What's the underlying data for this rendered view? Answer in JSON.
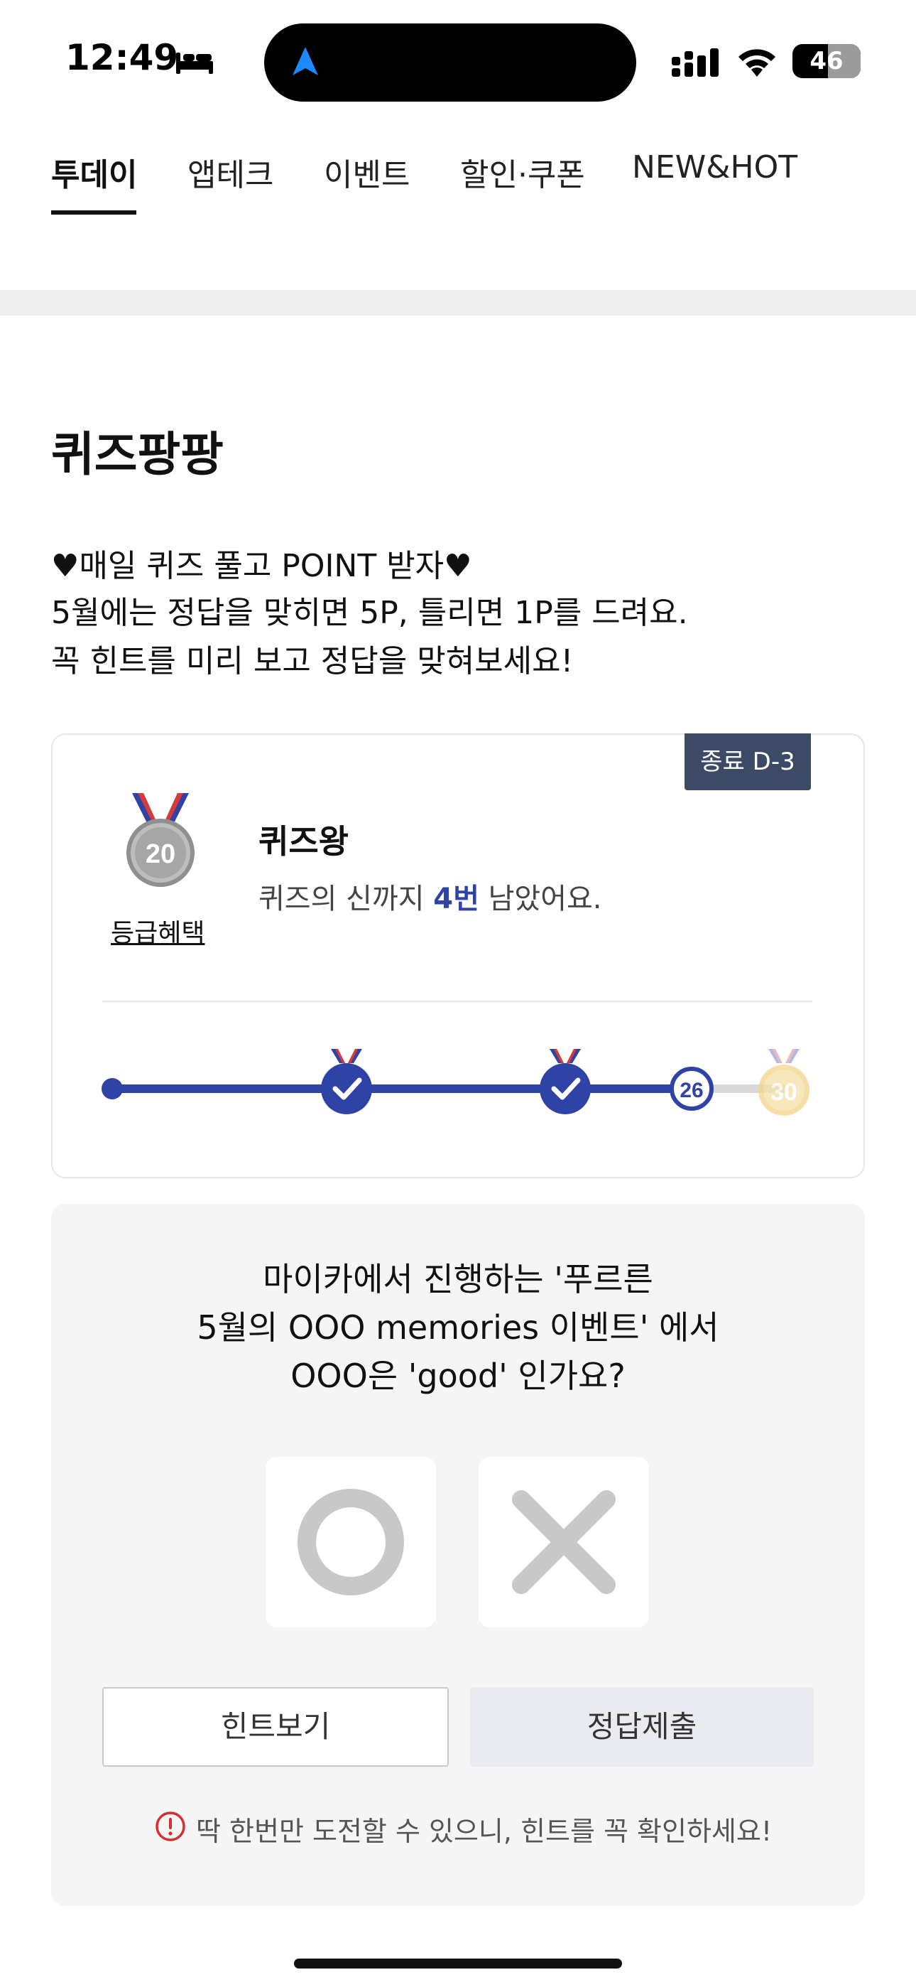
{
  "status_bar": {
    "time": "12:49",
    "battery_level": "46",
    "icons": [
      "bed-icon",
      "navigation-arrow-icon",
      "cellular-signal-icon",
      "wifi-icon",
      "battery-icon"
    ]
  },
  "tabs": [
    {
      "label": "투데이",
      "active": true
    },
    {
      "label": "앱테크",
      "active": false
    },
    {
      "label": "이벤트",
      "active": false
    },
    {
      "label": "할인·쿠폰",
      "active": false
    },
    {
      "label": "NEW&HOT",
      "active": false
    }
  ],
  "section": {
    "title": "퀴즈팡팡",
    "description": [
      "♥매일 퀴즈 풀고 POINT 받자♥",
      "5월에는 정답을 맞히면 5P, 틀리면 1P를 드려요.",
      "꼭 힌트를 미리 보고 정답을 맞혀보세요!"
    ]
  },
  "grade_card": {
    "dday_badge": "종료 D-3",
    "medal_number": "20",
    "grade_link": "등급혜택",
    "grade_title": "퀴즈왕",
    "remain_prefix": "퀴즈의 신까지 ",
    "remain_count": "4번",
    "remain_suffix": " 남았어요.",
    "progress": {
      "current_marker": "26",
      "goal_medal": "30",
      "completed_checkpoints": 2,
      "colors": {
        "accent": "#2f43a6",
        "track": "#d9d9d9",
        "gold": "#f2d58a"
      }
    }
  },
  "quiz": {
    "question": [
      "마이카에서 진행하는 '푸르른",
      "5월의 OOO memories 이벤트' 에서",
      "OOO은 'good' 인가요?"
    ],
    "option_o": "O",
    "option_x": "X",
    "hint_button": "힌트보기",
    "submit_button": "정답제출",
    "warning": "딱 한번만 도전할 수 있으니, 힌트를 꼭 확인하세요!"
  }
}
